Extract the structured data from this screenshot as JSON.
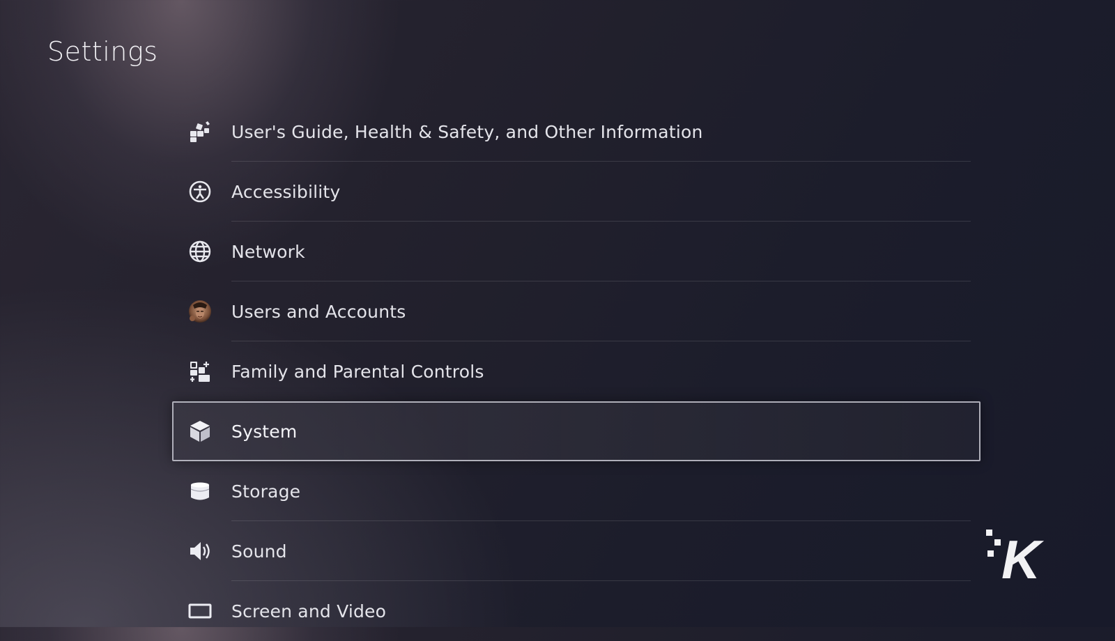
{
  "page": {
    "title": "Settings"
  },
  "menu": {
    "items": [
      {
        "label": "User's Guide, Health & Safety, and Other Information",
        "icon": "guide-icon",
        "selected": false
      },
      {
        "label": "Accessibility",
        "icon": "accessibility-icon",
        "selected": false
      },
      {
        "label": "Network",
        "icon": "globe-icon",
        "selected": false
      },
      {
        "label": "Users and Accounts",
        "icon": "user-avatar-icon",
        "selected": false
      },
      {
        "label": "Family and Parental Controls",
        "icon": "family-controls-icon",
        "selected": false
      },
      {
        "label": "System",
        "icon": "cube-icon",
        "selected": true
      },
      {
        "label": "Storage",
        "icon": "storage-icon",
        "selected": false
      },
      {
        "label": "Sound",
        "icon": "speaker-icon",
        "selected": false
      },
      {
        "label": "Screen and Video",
        "icon": "screen-icon",
        "selected": false
      }
    ]
  },
  "watermark": {
    "text": "K",
    "icon": "knowtechie-logo-icon"
  },
  "colors": {
    "text": "#e4e4ea",
    "highlight_border": "#dcdce6",
    "background": "#1c1d2b"
  }
}
